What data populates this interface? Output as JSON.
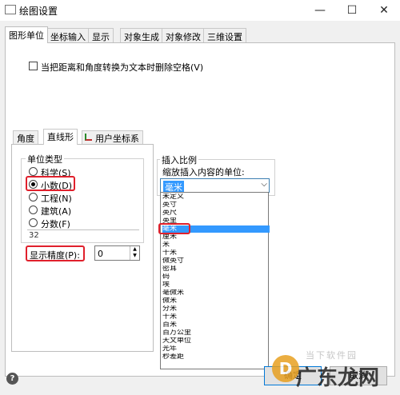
{
  "window": {
    "title": "绘图设置",
    "minimize": "—",
    "maximize": "☐",
    "close": "✕"
  },
  "tabs": [
    "图形单位",
    "坐标输入",
    "显示",
    "对象生成",
    "对象修改",
    "三维设置"
  ],
  "options": {
    "convert_checkbox_label": "当把距离和角度转换为文本时删除空格(V)",
    "convert_checked": false
  },
  "subtabs": [
    "角度",
    "直线形",
    "用户坐标系"
  ],
  "unit_type": {
    "title": "单位类型",
    "options": [
      "科学(S)",
      "小数(D)",
      "工程(N)",
      "建筑(A)",
      "分数(F)"
    ],
    "selected": "小数(D)",
    "sample": "32"
  },
  "precision": {
    "label": "显示精度(P):",
    "value": "0"
  },
  "insert_scale": {
    "title": "插入比例",
    "label": "缩放插入内容的单位:",
    "selected": "毫米",
    "list": [
      "未定义",
      "英寸",
      "英尺",
      "英里",
      "毫米",
      "厘米",
      "米",
      "千米",
      "微英寸",
      "密耳",
      "码",
      "埃",
      "毫微米",
      "微米",
      "分米",
      "十米",
      "百米",
      "百万公里",
      "天文单位",
      "光年",
      "秒差距"
    ]
  },
  "footer": {
    "help": "?",
    "ok_label": "确定",
    "cancel_label": "取消"
  },
  "watermark": {
    "text": "广东龙网",
    "subtext": "当下软件园"
  },
  "colors": {
    "highlight": "#e0202c",
    "selection": "#3399ff"
  }
}
